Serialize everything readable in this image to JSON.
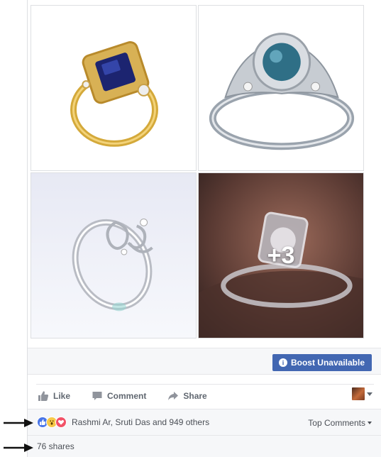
{
  "photos": {
    "more_overlay": "+3",
    "alts": [
      "gold-sapphire-ring",
      "blue-halo-ring",
      "silver-crown-ring",
      "diamond-ring-on-hand"
    ]
  },
  "boost": {
    "label": "Boost Unavailable",
    "info_glyph": "i"
  },
  "actions": {
    "like": "Like",
    "comment": "Comment",
    "share": "Share"
  },
  "reactions": {
    "icons": [
      "like-icon",
      "wow-icon",
      "love-icon"
    ],
    "text": "Rashmi Ar, Sruti Das and 949 others",
    "sort_label": "Top Comments"
  },
  "shares": {
    "text": "76 shares"
  },
  "colors": {
    "accent": "#4267b2",
    "like": "#4a76e8",
    "wow": "#f7c948",
    "love": "#f25268",
    "panel": "#f6f7f9",
    "muted_text": "#606770"
  }
}
